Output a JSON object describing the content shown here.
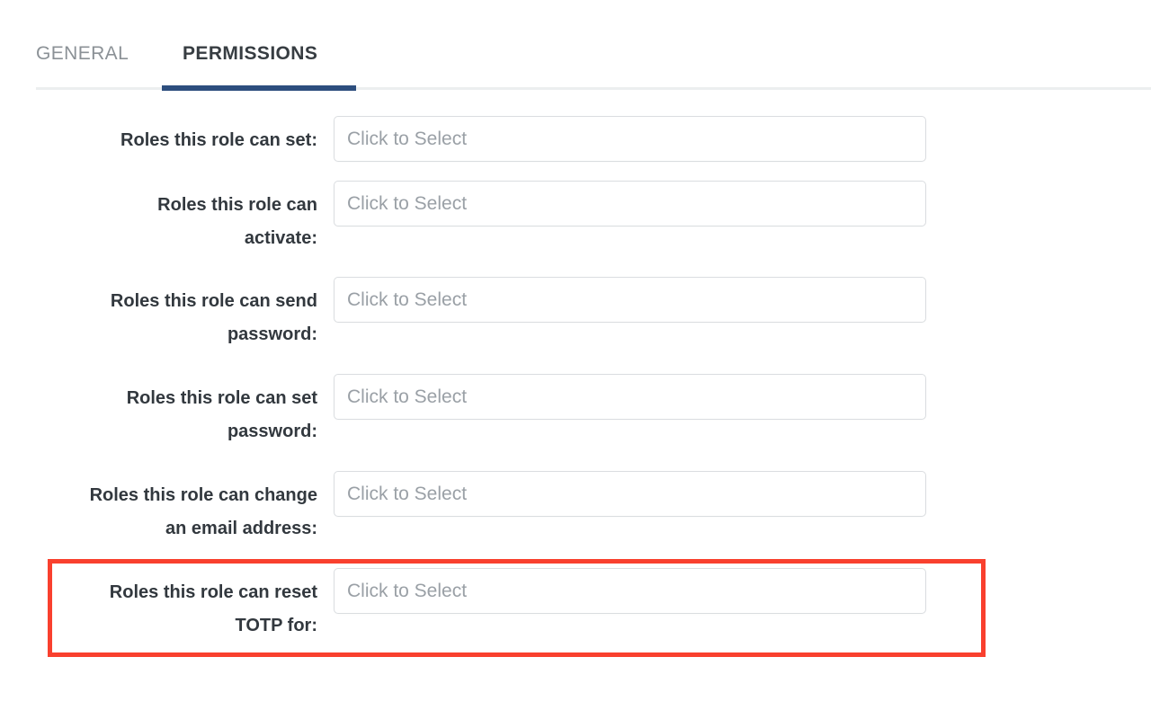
{
  "tabs": [
    {
      "label": "GENERAL",
      "active": false
    },
    {
      "label": "PERMISSIONS",
      "active": true
    }
  ],
  "colors": {
    "active_tab_underline": "#2d4e7e",
    "active_tab_text": "#373d42",
    "inactive_tab_text": "#8b9196",
    "label_text": "#32383e",
    "placeholder_text": "#9aa0a6",
    "input_border": "#dadde0",
    "divider": "#eceeef",
    "highlight_border": "#f9402e",
    "page_background": "#ffffff"
  },
  "form": {
    "fields": [
      {
        "label": "Roles this role can set:",
        "placeholder": "Click to Select",
        "value": "",
        "highlighted": false
      },
      {
        "label": "Roles this role can\nactivate:",
        "placeholder": "Click to Select",
        "value": "",
        "highlighted": false
      },
      {
        "label": "Roles this role can send\npassword:",
        "placeholder": "Click to Select",
        "value": "",
        "highlighted": false
      },
      {
        "label": "Roles this role can set\npassword:",
        "placeholder": "Click to Select",
        "value": "",
        "highlighted": false
      },
      {
        "label": "Roles this role can change\nan email address:",
        "placeholder": "Click to Select",
        "value": "",
        "highlighted": false
      },
      {
        "label": "Roles this role can reset\nTOTP for:",
        "placeholder": "Click to Select",
        "value": "",
        "highlighted": true
      }
    ]
  }
}
